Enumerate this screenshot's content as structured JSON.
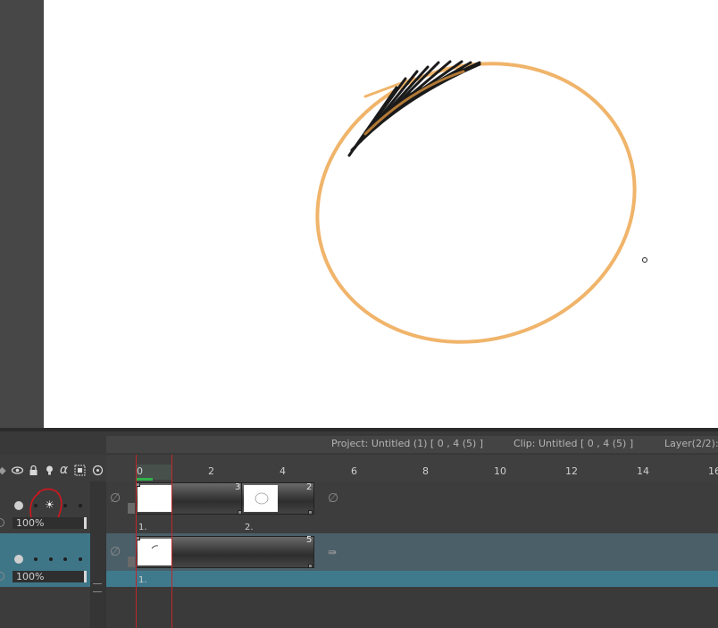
{
  "status": {
    "project": "Project: Untitled (1) [ 0 , 4  (5) ]",
    "clip": "Clip: Untitled [ 0 , 4  (5) ]",
    "layer": "Layer(2/2):"
  },
  "ruler": {
    "ticks": [
      "0",
      "2",
      "4",
      "6",
      "8",
      "10",
      "12",
      "14",
      "16"
    ]
  },
  "header_icons": [
    "eye-icon",
    "lock-icon",
    "lightbulb-icon",
    "alpha-icon",
    "selection-icon",
    "onion-skin-icon"
  ],
  "layers": [
    {
      "opacity": "100%",
      "clips": [
        {
          "frames": "3",
          "label": "1."
        },
        {
          "frames": "2",
          "label": "2."
        }
      ]
    },
    {
      "opacity": "100%",
      "clips": [
        {
          "frames": "5",
          "label": "1."
        }
      ]
    }
  ],
  "colors": {
    "stroke_orange": "#f0b46a",
    "stroke_black": "#1a1a1a",
    "playhead": "#c0262a",
    "selected_row": "#3e7688",
    "annotation_red": "#d4161c"
  }
}
